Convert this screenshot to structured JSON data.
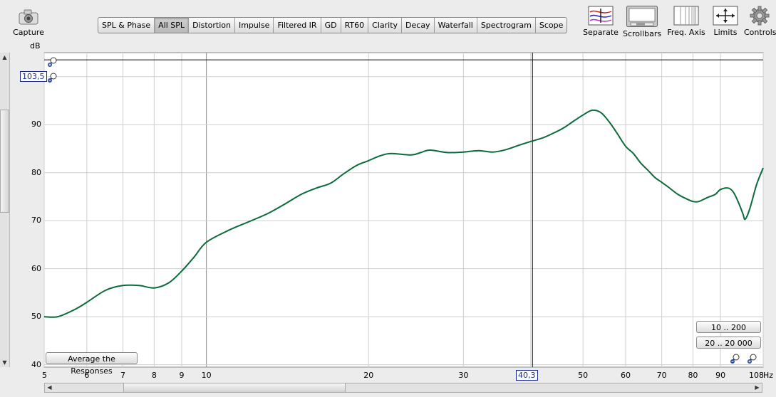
{
  "toolbar": {
    "capture_label": "Capture",
    "right_tools": [
      {
        "label": "Separate"
      },
      {
        "label": "Scrollbars"
      },
      {
        "label": "Freq. Axis"
      },
      {
        "label": "Limits"
      },
      {
        "label": "Controls"
      }
    ]
  },
  "tabs": [
    {
      "label": "SPL & Phase",
      "active": false
    },
    {
      "label": "All SPL",
      "active": true
    },
    {
      "label": "Distortion",
      "active": false
    },
    {
      "label": "Impulse",
      "active": false
    },
    {
      "label": "Filtered IR",
      "active": false
    },
    {
      "label": "GD",
      "active": false
    },
    {
      "label": "RT60",
      "active": false
    },
    {
      "label": "Clarity",
      "active": false
    },
    {
      "label": "Decay",
      "active": false
    },
    {
      "label": "Waterfall",
      "active": false
    },
    {
      "label": "Spectrogram",
      "active": false
    },
    {
      "label": "Scope",
      "active": false
    }
  ],
  "plot": {
    "y_unit": "dB",
    "x_unit": "Hz",
    "cursor_y_readout": "103,5",
    "cursor_x_readout": "40,3",
    "average_button": "Average the Responses",
    "preset_low": "10 .. 200",
    "preset_full": "20 .. 20 000",
    "colors": {
      "trace": "#0b6b3a",
      "plot_bg": "#ffffff",
      "grid": "#cfcfcf"
    }
  },
  "chart_data": {
    "type": "line",
    "xscale": "log",
    "xlim": [
      5,
      108
    ],
    "ylim": [
      39.5,
      105
    ],
    "cursor": {
      "x": 40.3,
      "y": 103.5
    },
    "x_ticks": [
      5,
      6,
      7,
      8,
      9,
      10,
      20,
      30,
      40,
      50,
      60,
      70,
      80,
      90,
      108
    ],
    "x_tick_labels": [
      "5",
      "6",
      "7",
      "8",
      "9",
      "10",
      "20",
      "30",
      "",
      "50",
      "60",
      "70",
      "80",
      "90",
      "108"
    ],
    "y_ticks": [
      40,
      50,
      60,
      70,
      80,
      90,
      100
    ],
    "grid": true,
    "series": [
      {
        "x": [
          5,
          5.3,
          5.7,
          6,
          6.5,
          7,
          7.5,
          8,
          8.5,
          9,
          9.5,
          10,
          11,
          12,
          13,
          14,
          15,
          16,
          17,
          18,
          19,
          20,
          21,
          22,
          24,
          25,
          26,
          28,
          30,
          32,
          34,
          36,
          38,
          40,
          42,
          44,
          46,
          48,
          50,
          52,
          54,
          56,
          58,
          60,
          62,
          64,
          66,
          68,
          70,
          72,
          75,
          78,
          80,
          82,
          85,
          88,
          90,
          93,
          95,
          97,
          99,
          100,
          102,
          105,
          108
        ],
        "y": [
          50,
          50,
          51.5,
          53,
          55.5,
          56.5,
          56.5,
          56,
          57,
          59.5,
          62.5,
          65.5,
          68,
          69.8,
          71.5,
          73.5,
          75.5,
          76.8,
          77.8,
          79.8,
          81.5,
          82.5,
          83.5,
          84,
          83.7,
          84.2,
          84.7,
          84.2,
          84.3,
          84.6,
          84.3,
          84.8,
          85.7,
          86.5,
          87.2,
          88.2,
          89.3,
          90.7,
          92,
          93,
          92.5,
          90.5,
          88,
          85.5,
          84,
          82,
          80.5,
          79,
          78,
          77,
          75.5,
          74.5,
          74,
          74,
          74.8,
          75.5,
          76.5,
          76.8,
          76,
          74,
          71.5,
          70.3,
          72.5,
          77.5,
          81
        ]
      }
    ]
  }
}
